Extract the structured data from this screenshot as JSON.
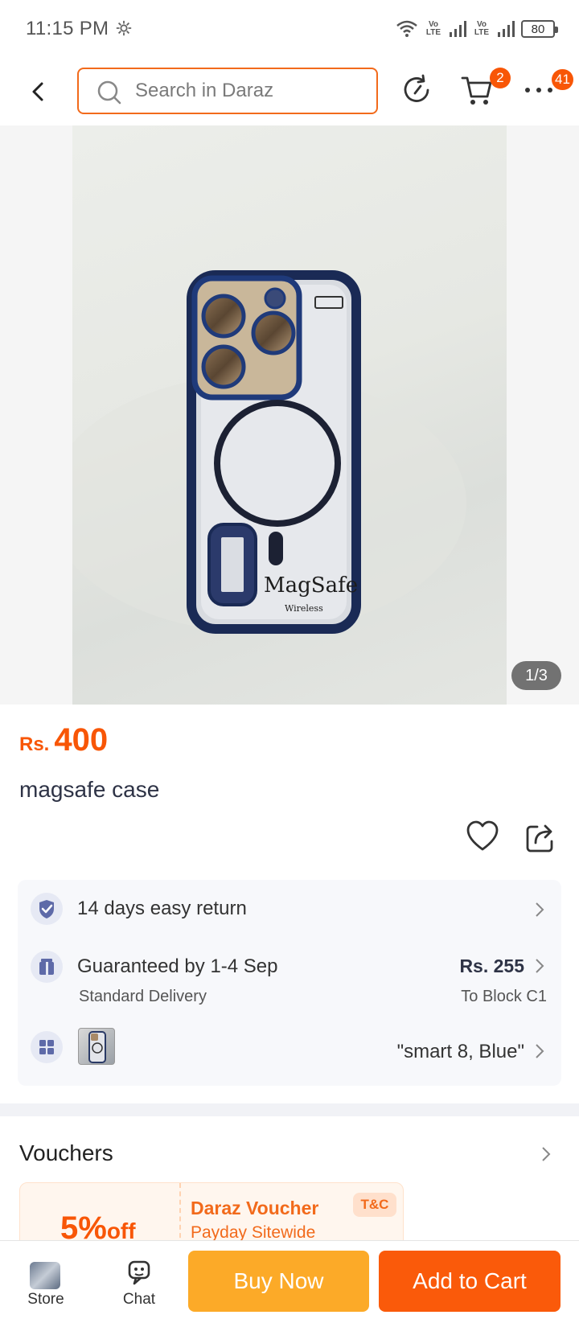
{
  "status_bar": {
    "time": "11:15 PM",
    "volte_1": "Vo LTE",
    "volte_2": "Vo LTE",
    "battery": "80",
    "icons": [
      "settings-gear-icon",
      "wifi-icon",
      "signal-icon",
      "battery-icon"
    ]
  },
  "top_nav": {
    "search_placeholder": "Search in Daraz",
    "cart_badge": "2",
    "more_badge": "41",
    "icons": [
      "back-arrow-icon",
      "search-icon",
      "history-icon",
      "cart-icon",
      "more-icon"
    ]
  },
  "gallery": {
    "counter": "1/3",
    "photo_case_text": "MagSafe",
    "photo_case_subtext": "Wireless"
  },
  "product": {
    "currency": "Rs.",
    "price": "400",
    "title": "magsafe case"
  },
  "info": {
    "return_text": "14 days easy return",
    "delivery_text": "Guaranteed by 1-4 Sep",
    "delivery_type": "Standard Delivery",
    "delivery_fee": "Rs. 255",
    "delivery_to": "To Block C1",
    "variant": "\"smart 8, Blue\""
  },
  "vouchers": {
    "title": "Vouchers",
    "card": {
      "percent": "5%",
      "off": "off",
      "name": "Daraz Voucher",
      "desc": "Payday Sitewide",
      "tc": "T&C"
    }
  },
  "bottom_bar": {
    "store_label": "Store",
    "chat_label": "Chat",
    "buy_now_label": "Buy Now",
    "add_to_cart_label": "Add to Cart"
  },
  "colors": {
    "brand_orange": "#f85606",
    "buy_now": "#fcaa28",
    "add_to_cart": "#fa5a0a"
  }
}
